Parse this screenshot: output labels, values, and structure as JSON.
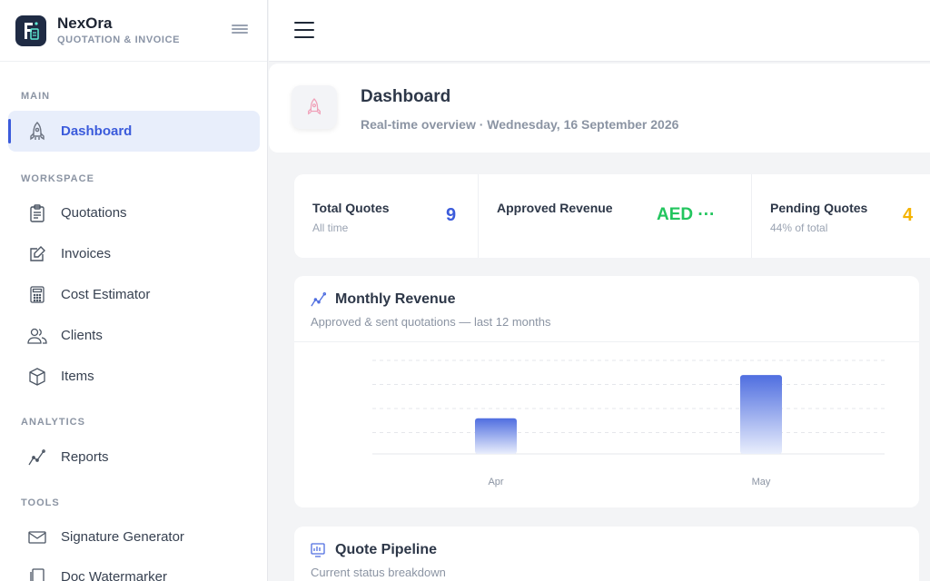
{
  "brand": {
    "name": "NexOra",
    "subtitle": "QUOTATION & INVOICE"
  },
  "nav": {
    "sections": [
      {
        "title": "MAIN"
      },
      {
        "title": "WORKSPACE"
      },
      {
        "title": "ANALYTICS"
      },
      {
        "title": "TOOLS"
      }
    ],
    "items": [
      {
        "label": "Dashboard",
        "icon": "rocket-icon",
        "active": true
      },
      {
        "label": "Quotations",
        "icon": "clipboard-icon"
      },
      {
        "label": "Invoices",
        "icon": "edit-note-icon"
      },
      {
        "label": "Cost Estimator",
        "icon": "calculator-icon"
      },
      {
        "label": "Clients",
        "icon": "users-icon"
      },
      {
        "label": "Items",
        "icon": "box-icon"
      },
      {
        "label": "Reports",
        "icon": "trend-line-icon"
      },
      {
        "label": "Signature Generator",
        "icon": "envelope-icon"
      },
      {
        "label": "Doc Watermarker",
        "icon": "document-copy-icon"
      }
    ]
  },
  "header": {
    "title": "Dashboard",
    "subtitle": "Real-time overview · Wednesday, 16 September 2026"
  },
  "stats": [
    {
      "label": "Total Quotes",
      "sub": "All time",
      "value": "9",
      "color": "#3b5bdb"
    },
    {
      "label": "Approved Revenue",
      "sub": "",
      "value": "AED ···",
      "color": "#22c55e"
    },
    {
      "label": "Pending Quotes",
      "sub": "44% of total",
      "value": "4",
      "color": "#f5b301"
    }
  ],
  "revenue": {
    "title": "Monthly Revenue",
    "subtitle": "Approved & sent quotations — last 12 months"
  },
  "pipeline": {
    "title": "Quote Pipeline",
    "subtitle": "Current status breakdown"
  },
  "chart_data": {
    "type": "bar",
    "categories": [
      "Apr",
      "May"
    ],
    "values": [
      37,
      82
    ],
    "ylim": [
      0,
      100
    ],
    "grid": true,
    "bar_color": "#4f6ee0"
  }
}
